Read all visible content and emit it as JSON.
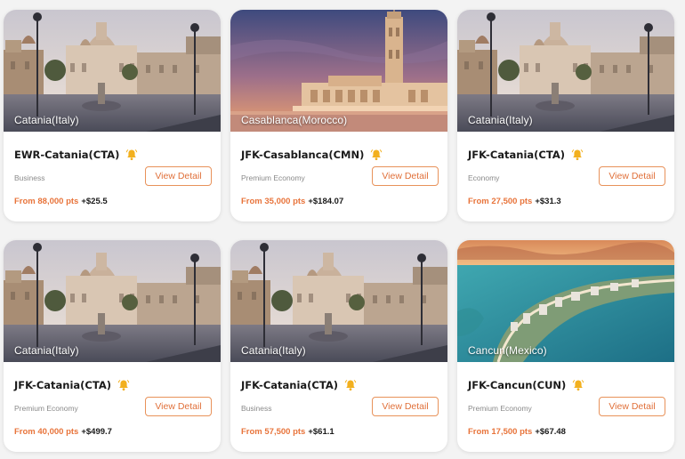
{
  "colors": {
    "accent": "#e8743b",
    "button_border": "#e8925a",
    "bell": "#f2b01e"
  },
  "cards": [
    {
      "city": "Catania(Italy)",
      "route": "EWR-Catania(CTA)",
      "cabin": "Business",
      "pts": "From 88,000 pts",
      "cash": "+$25.5",
      "button": "View Detail",
      "scene": "catania"
    },
    {
      "city": "Casablanca(Morocco)",
      "route": "JFK-Casablanca(CMN)",
      "cabin": "Premium Economy",
      "pts": "From 35,000 pts",
      "cash": "+$184.07",
      "button": "View Detail",
      "scene": "casablanca"
    },
    {
      "city": "Catania(Italy)",
      "route": "JFK-Catania(CTA)",
      "cabin": "Economy",
      "pts": "From 27,500 pts",
      "cash": "+$31.3",
      "button": "View Detail",
      "scene": "catania"
    },
    {
      "city": "Catania(Italy)",
      "route": "JFK-Catania(CTA)",
      "cabin": "Premium Economy",
      "pts": "From 40,000 pts",
      "cash": "+$499.7",
      "button": "View Detail",
      "scene": "catania"
    },
    {
      "city": "Catania(Italy)",
      "route": "JFK-Catania(CTA)",
      "cabin": "Business",
      "pts": "From 57,500 pts",
      "cash": "+$61.1",
      "button": "View Detail",
      "scene": "catania"
    },
    {
      "city": "Cancun(Mexico)",
      "route": "JFK-Cancun(CUN)",
      "cabin": "Premium Economy",
      "pts": "From 17,500 pts",
      "cash": "+$67.48",
      "button": "View Detail",
      "scene": "cancun"
    }
  ]
}
